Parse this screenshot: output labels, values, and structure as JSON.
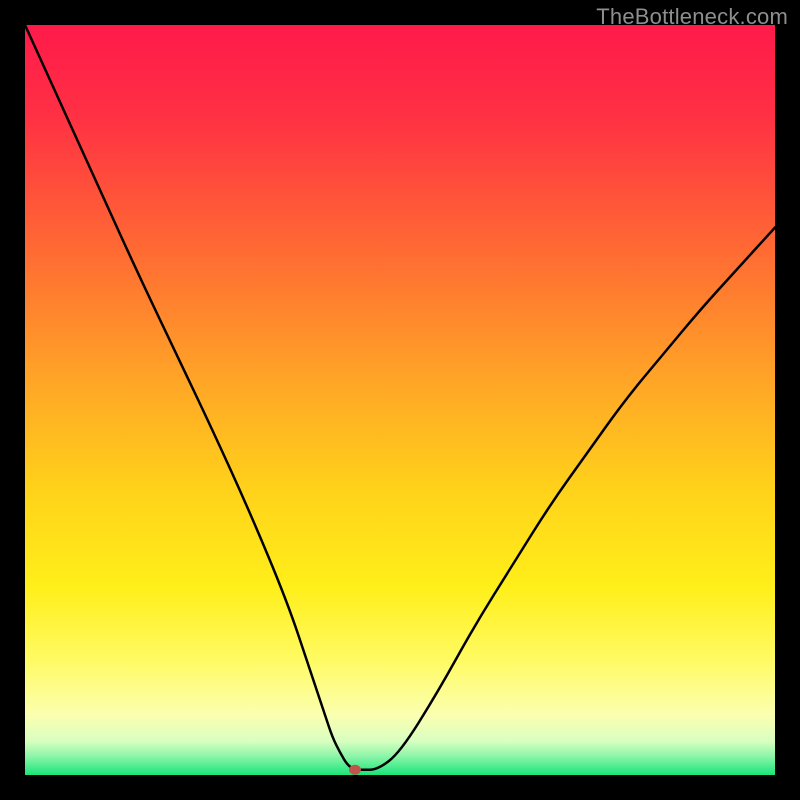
{
  "watermark": "TheBottleneck.com",
  "chart_data": {
    "type": "line",
    "title": "",
    "xlabel": "",
    "ylabel": "",
    "xlim": [
      0,
      100
    ],
    "ylim": [
      0,
      100
    ],
    "background_gradient": {
      "stops": [
        {
          "offset": 0.0,
          "color": "#ff1a4a"
        },
        {
          "offset": 0.12,
          "color": "#ff3044"
        },
        {
          "offset": 0.3,
          "color": "#ff6a33"
        },
        {
          "offset": 0.48,
          "color": "#ffa726"
        },
        {
          "offset": 0.62,
          "color": "#ffd21a"
        },
        {
          "offset": 0.75,
          "color": "#ffef1a"
        },
        {
          "offset": 0.85,
          "color": "#fffb66"
        },
        {
          "offset": 0.92,
          "color": "#fbffb0"
        },
        {
          "offset": 0.955,
          "color": "#d8ffc0"
        },
        {
          "offset": 0.975,
          "color": "#8cf5a8"
        },
        {
          "offset": 1.0,
          "color": "#18e57a"
        }
      ]
    },
    "series": [
      {
        "name": "bottleneck-curve",
        "color": "#000000",
        "stroke_width": 2.5,
        "x": [
          0,
          5,
          10,
          15,
          20,
          25,
          30,
          35,
          38,
          40,
          41,
          42,
          43,
          44,
          45,
          47,
          50,
          55,
          60,
          65,
          70,
          75,
          80,
          85,
          90,
          95,
          100
        ],
        "values": [
          100,
          89,
          78,
          67,
          56.5,
          46,
          35,
          23,
          14,
          8,
          5,
          3,
          1.3,
          0.7,
          0.7,
          0.7,
          3,
          11,
          20,
          28,
          36,
          43,
          50,
          56,
          62,
          67.5,
          73
        ]
      }
    ],
    "marker": {
      "name": "optimum-marker",
      "x": 44,
      "y": 0.7,
      "rx": 6,
      "ry": 5,
      "fill": "#c0564b"
    }
  }
}
